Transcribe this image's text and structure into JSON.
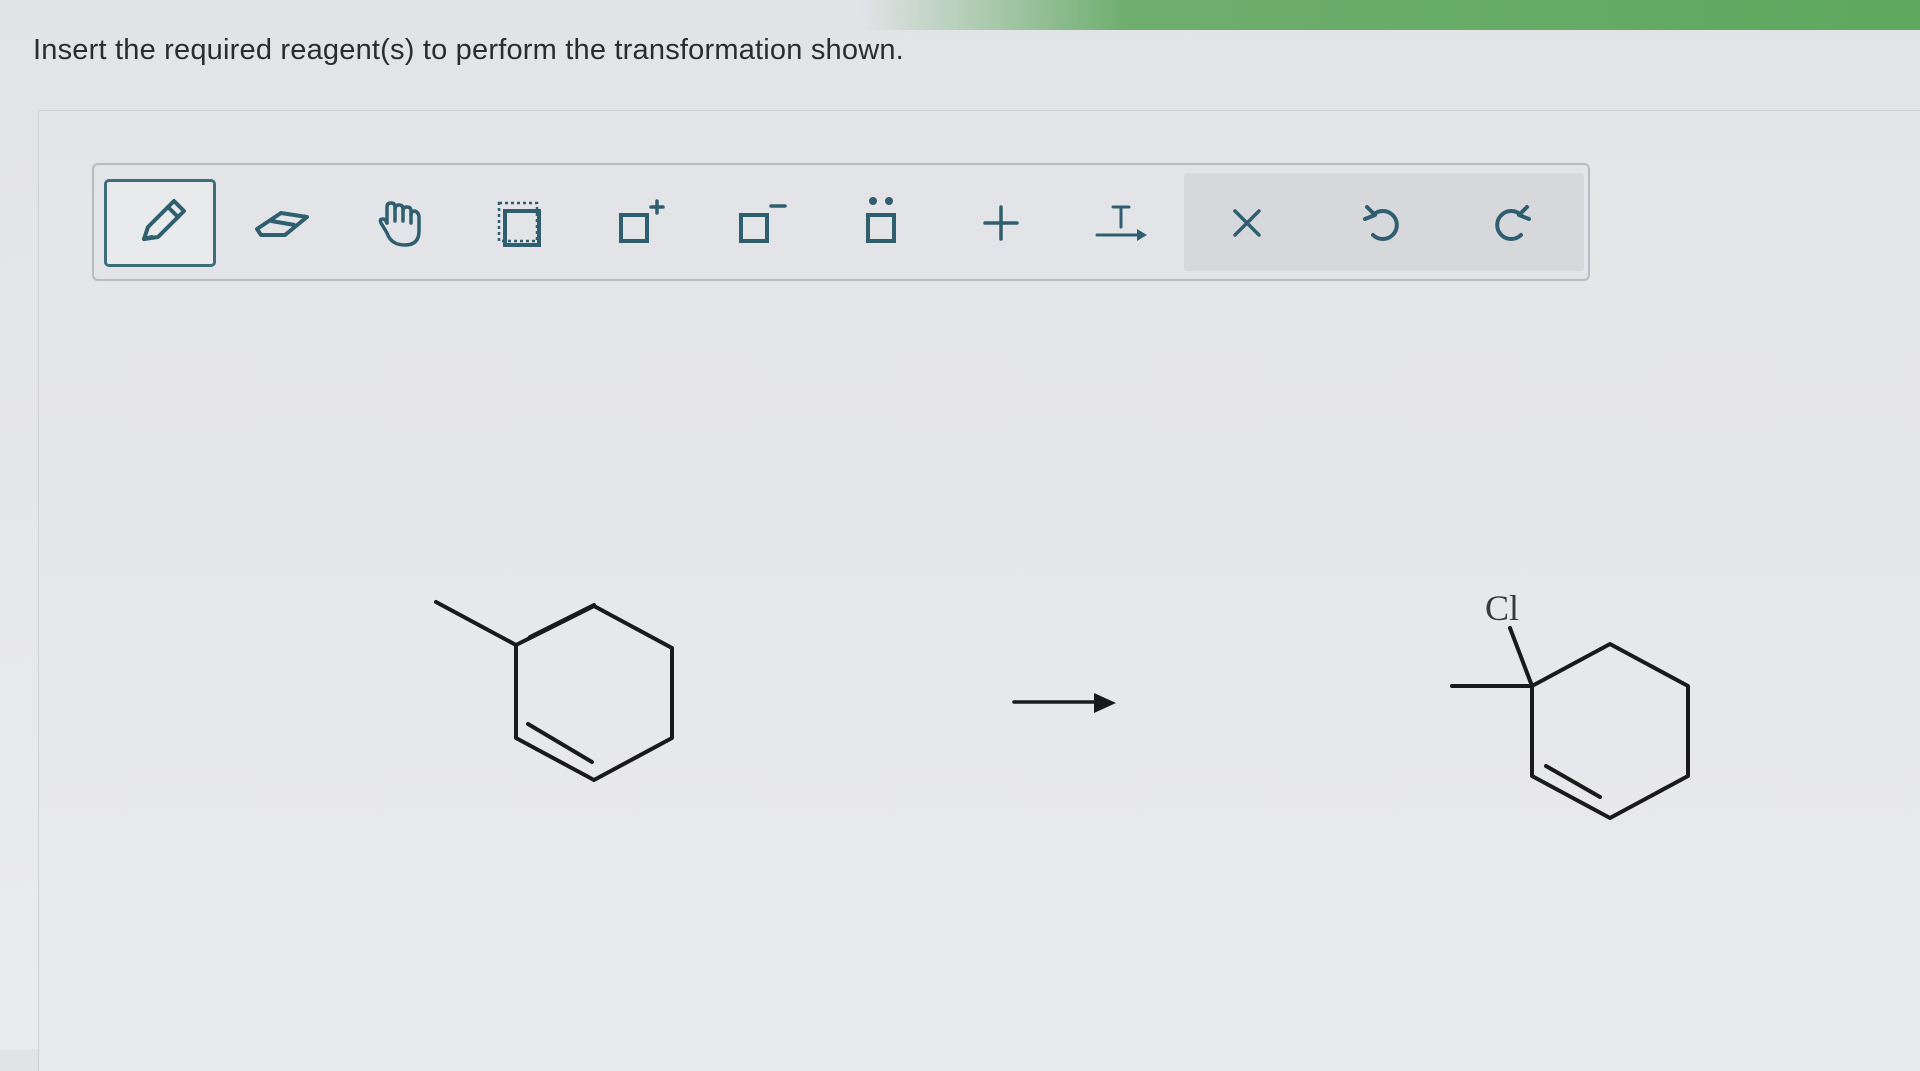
{
  "question": {
    "prompt": "Insert the required reagent(s) to perform the transformation shown."
  },
  "toolbar": {
    "tools": [
      {
        "name": "pencil-tool",
        "icon": "pencil-icon",
        "active": true
      },
      {
        "name": "eraser-tool",
        "icon": "eraser-icon",
        "active": false
      },
      {
        "name": "hand-tool",
        "icon": "hand-icon",
        "active": false
      },
      {
        "name": "select-tool",
        "icon": "selection-box-icon",
        "active": false
      },
      {
        "name": "positive-charge-tool",
        "icon": "plus-charge-icon",
        "active": false
      },
      {
        "name": "negative-charge-tool",
        "icon": "minus-charge-icon",
        "active": false
      },
      {
        "name": "lone-pair-tool",
        "icon": "lone-pair-icon",
        "active": false
      },
      {
        "name": "add-plus-tool",
        "icon": "plus-icon",
        "active": false
      },
      {
        "name": "reagent-text-tool",
        "icon": "text-arrow-icon",
        "active": false
      },
      {
        "name": "clear-tool",
        "icon": "close-icon",
        "active": false
      },
      {
        "name": "undo-tool",
        "icon": "undo-icon",
        "active": false
      },
      {
        "name": "redo-tool",
        "icon": "redo-icon",
        "active": false
      }
    ],
    "icon_color": "#2f5f6e",
    "accent_color": "#3c6e7c"
  },
  "reaction": {
    "reactant": "1-methylcyclohexa-1,4-diene",
    "product": {
      "substituent_label": "Cl"
    },
    "arrow_icon": "reaction-arrow"
  }
}
